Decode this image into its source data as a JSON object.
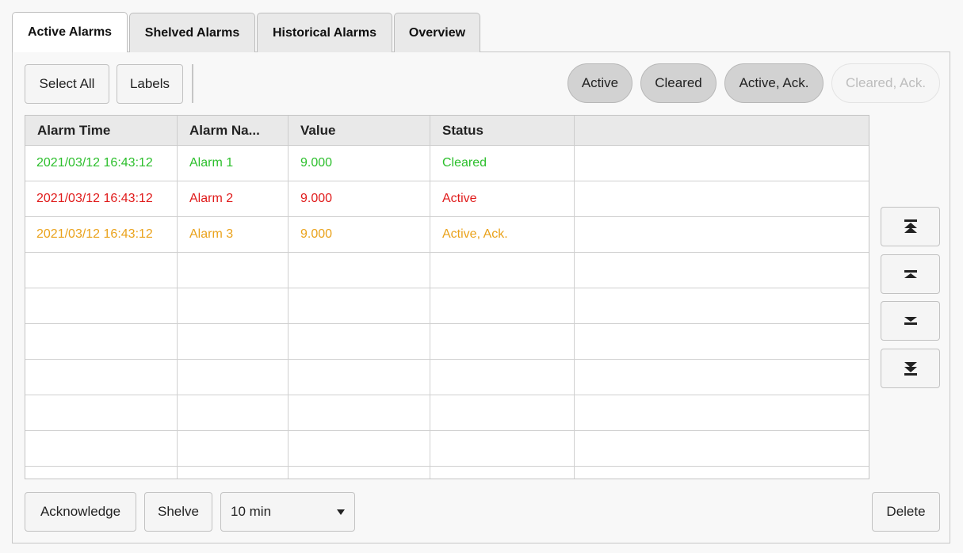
{
  "tabs": [
    {
      "label": "Active Alarms",
      "active": true
    },
    {
      "label": "Shelved Alarms",
      "active": false
    },
    {
      "label": "Historical Alarms",
      "active": false
    },
    {
      "label": "Overview",
      "active": false
    }
  ],
  "toolbar": {
    "select_all": "Select All",
    "labels": "Labels"
  },
  "filters": [
    {
      "label": "Active",
      "enabled": true
    },
    {
      "label": "Cleared",
      "enabled": true
    },
    {
      "label": "Active, Ack.",
      "enabled": true
    },
    {
      "label": "Cleared, Ack.",
      "enabled": false
    }
  ],
  "table": {
    "columns": [
      "Alarm Time",
      "Alarm Na...",
      "Value",
      "Status",
      ""
    ],
    "rows": [
      {
        "time": "2021/03/12 16:43:12",
        "name": "Alarm 1",
        "value": "9.000",
        "status": "Cleared",
        "color": "#2cbf2c"
      },
      {
        "time": "2021/03/12 16:43:12",
        "name": "Alarm 2",
        "value": "9.000",
        "status": "Active",
        "color": "#e01b1b"
      },
      {
        "time": "2021/03/12 16:43:12",
        "name": "Alarm 3",
        "value": "9.000",
        "status": "Active, Ack.",
        "color": "#eaa21b"
      }
    ]
  },
  "navigation": {
    "first_icon": "scroll-to-top-icon",
    "prev_icon": "page-up-icon",
    "next_icon": "page-down-icon",
    "last_icon": "scroll-to-bottom-icon"
  },
  "bottom": {
    "acknowledge": "Acknowledge",
    "shelve": "Shelve",
    "shelve_duration": "10 min",
    "delete": "Delete"
  }
}
